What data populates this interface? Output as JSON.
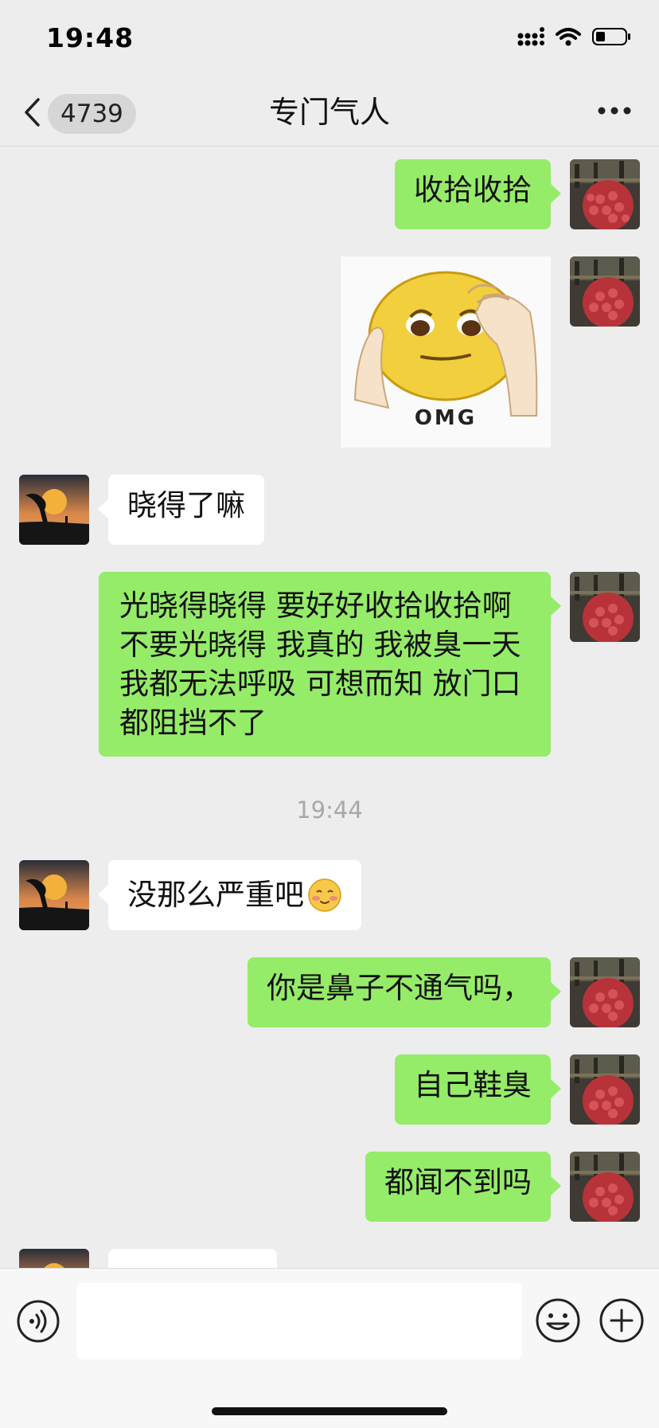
{
  "status": {
    "time": "19:48"
  },
  "header": {
    "unread_count": "4739",
    "title": "专门气人"
  },
  "messages": {
    "m1": "收拾收拾",
    "m2_caption": "OMG",
    "m3": "晓得了嘛",
    "m4": "光晓得晓得 要好好收拾收拾啊 不要光晓得 我真的 我被臭一天 我都无法呼吸 可想而知 放门口 都阻挡不了",
    "timestamp": "19:44",
    "m5": "没那么严重吧",
    "m5_emoji": "☺",
    "m6": "你是鼻子不通气吗，",
    "m7": "自己鞋臭",
    "m8": "都闻不到吗"
  },
  "input": {
    "placeholder": ""
  },
  "colors": {
    "my_bubble": "#95ec69",
    "their_bubble": "#ffffff",
    "background": "#ededed"
  },
  "icons": [
    "signal-icon",
    "wifi-icon",
    "battery-icon",
    "back-chevron-icon",
    "more-icon",
    "voice-icon",
    "emoji-icon",
    "plus-icon"
  ]
}
